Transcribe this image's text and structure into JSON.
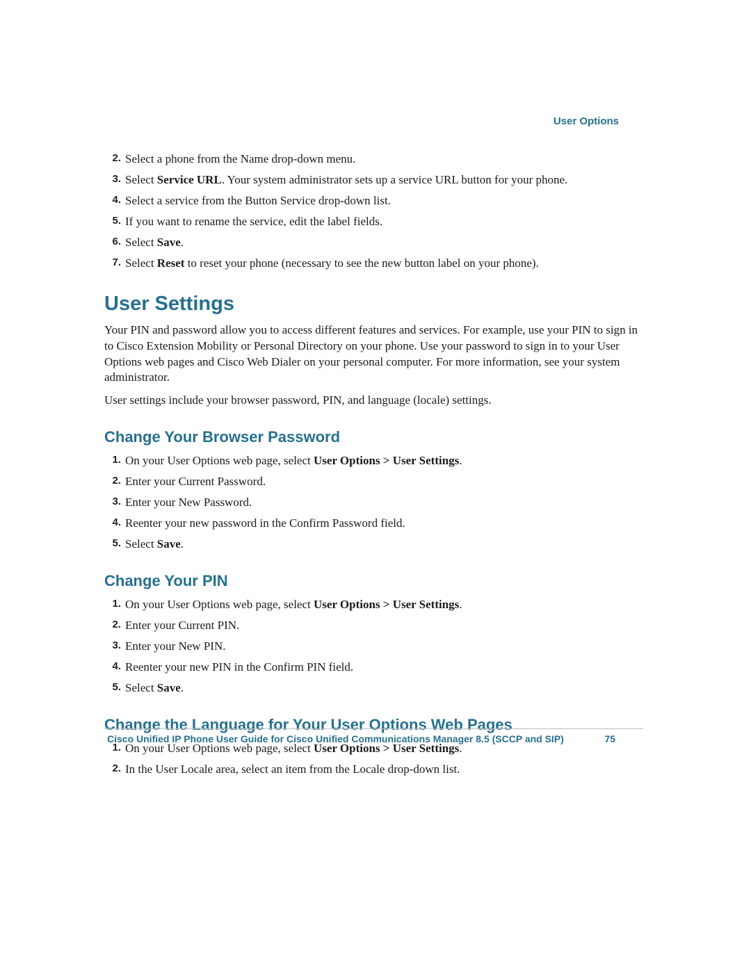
{
  "runningHead": "User Options",
  "topSteps": [
    [
      {
        "t": "Select a phone from the Name drop-down menu."
      }
    ],
    [
      {
        "t": "Select "
      },
      {
        "t": "Service URL",
        "b": true
      },
      {
        "t": ". Your system administrator sets up a service URL button for your phone."
      }
    ],
    [
      {
        "t": "Select a service from the Button Service drop-down list."
      }
    ],
    [
      {
        "t": "If you want to rename the service, edit the label fields."
      }
    ],
    [
      {
        "t": "Select "
      },
      {
        "t": "Save",
        "b": true
      },
      {
        "t": "."
      }
    ],
    [
      {
        "t": "Select "
      },
      {
        "t": "Reset",
        "b": true
      },
      {
        "t": " to reset your phone (necessary to see the new button label on your phone)."
      }
    ]
  ],
  "topStepsStart": 2,
  "h1": "User Settings",
  "intro1": "Your PIN and password allow you to access different features and services. For example, use your PIN to sign in to Cisco Extension Mobility or Personal Directory on your phone. Use your password to sign in to your User Options web pages and Cisco Web Dialer on your personal computer. For more information, see your system administrator.",
  "intro2": "User settings include your browser password, PIN, and language (locale) settings.",
  "secA": {
    "title": "Change Your Browser Password",
    "steps": [
      [
        {
          "t": "On your User Options web page, select "
        },
        {
          "t": "User Options > User Settings",
          "b": true
        },
        {
          "t": "."
        }
      ],
      [
        {
          "t": "Enter your Current Password."
        }
      ],
      [
        {
          "t": "Enter your New Password."
        }
      ],
      [
        {
          "t": "Reenter your new password in the Confirm Password field."
        }
      ],
      [
        {
          "t": "Select "
        },
        {
          "t": "Save",
          "b": true
        },
        {
          "t": "."
        }
      ]
    ]
  },
  "secB": {
    "title": "Change Your PIN",
    "steps": [
      [
        {
          "t": "On your User Options web page, select "
        },
        {
          "t": "User Options > User Settings",
          "b": true
        },
        {
          "t": "."
        }
      ],
      [
        {
          "t": "Enter your Current PIN."
        }
      ],
      [
        {
          "t": "Enter your New PIN."
        }
      ],
      [
        {
          "t": "Reenter your new PIN in the Confirm PIN field."
        }
      ],
      [
        {
          "t": "Select "
        },
        {
          "t": "Save",
          "b": true
        },
        {
          "t": "."
        }
      ]
    ]
  },
  "secC": {
    "title": "Change the Language for Your User Options Web Pages",
    "steps": [
      [
        {
          "t": "On your User Options web page, select "
        },
        {
          "t": "User Options > User Settings",
          "b": true
        },
        {
          "t": "."
        }
      ],
      [
        {
          "t": "In the User Locale area, select an item from the Locale drop-down list."
        }
      ]
    ]
  },
  "footerTitle": "Cisco Unified IP Phone User Guide for Cisco Unified Communications Manager 8.5 (SCCP and SIP)",
  "pageNumber": "75"
}
